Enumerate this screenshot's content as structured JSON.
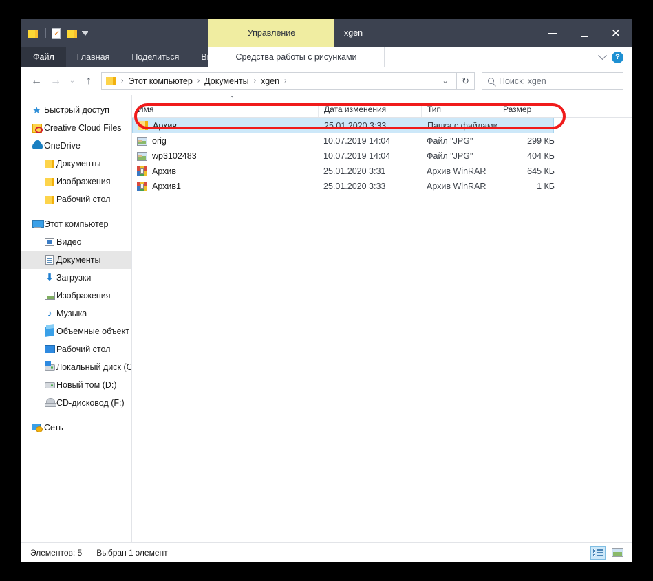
{
  "window": {
    "title": "xgen",
    "contextual_tab_header": "Управление",
    "controls": {
      "minimize": "–",
      "maximize": "□",
      "close": "✕"
    }
  },
  "quick_access_toolbar": {
    "items": [
      "new-folder-icon",
      "properties-icon",
      "open-folder-icon",
      "customize-dropdown-icon"
    ]
  },
  "ribbon": {
    "tabs": [
      {
        "label": "Файл",
        "active": true
      },
      {
        "label": "Главная",
        "active": false
      },
      {
        "label": "Поделиться",
        "active": false
      },
      {
        "label": "Вид",
        "active": false
      }
    ],
    "contextual_tab": "Средства работы с рисунками",
    "collapse_icon": "chevron-down-icon",
    "help_icon": "help-icon",
    "help_label": "?"
  },
  "address_bar": {
    "back_icon": "←",
    "forward_icon": "→",
    "recent_icon": "⌄",
    "up_icon": "↑",
    "breadcrumbs": [
      "Этот компьютер",
      "Документы",
      "xgen"
    ],
    "separator": "›",
    "dropdown_icon": "⌄",
    "refresh_icon": "↻"
  },
  "search": {
    "placeholder": "Поиск: xgen",
    "icon": "search-icon"
  },
  "sidebar": {
    "items": [
      {
        "label": "Быстрый доступ",
        "icon": "pin-star-icon",
        "level": 0,
        "selected": false
      },
      {
        "label": "Creative Cloud Files",
        "icon": "creative-cloud-icon",
        "level": 0,
        "selected": false
      },
      {
        "label": "OneDrive",
        "icon": "cloud-icon",
        "level": 0,
        "selected": false
      },
      {
        "label": "Документы",
        "icon": "folder-icon",
        "level": 1,
        "selected": false
      },
      {
        "label": "Изображения",
        "icon": "folder-icon",
        "level": 1,
        "selected": false
      },
      {
        "label": "Рабочий стол",
        "icon": "folder-icon",
        "level": 1,
        "selected": false
      },
      {
        "label": "Этот компьютер",
        "icon": "this-pc-icon",
        "level": 0,
        "selected": false
      },
      {
        "label": "Видео",
        "icon": "video-icon",
        "level": 1,
        "selected": false
      },
      {
        "label": "Документы",
        "icon": "documents-icon",
        "level": 1,
        "selected": true
      },
      {
        "label": "Загрузки",
        "icon": "downloads-icon",
        "level": 1,
        "selected": false
      },
      {
        "label": "Изображения",
        "icon": "pictures-icon",
        "level": 1,
        "selected": false
      },
      {
        "label": "Музыка",
        "icon": "music-icon",
        "level": 1,
        "selected": false
      },
      {
        "label": "Объемные объект",
        "icon": "3d-objects-icon",
        "level": 1,
        "selected": false
      },
      {
        "label": "Рабочий стол",
        "icon": "desktop-icon",
        "level": 1,
        "selected": false
      },
      {
        "label": "Локальный диск (C",
        "icon": "local-disk-icon",
        "level": 1,
        "selected": false
      },
      {
        "label": "Новый том (D:)",
        "icon": "drive-icon",
        "level": 1,
        "selected": false
      },
      {
        "label": "CD-дисковод (F:)",
        "icon": "cd-drive-icon",
        "level": 1,
        "selected": false
      },
      {
        "label": "Сеть",
        "icon": "network-icon",
        "level": 0,
        "selected": false
      }
    ]
  },
  "file_list": {
    "sort_indicator": "⌃",
    "columns": [
      {
        "key": "name",
        "label": "Имя"
      },
      {
        "key": "date",
        "label": "Дата изменения"
      },
      {
        "key": "type",
        "label": "Тип"
      },
      {
        "key": "size",
        "label": "Размер"
      }
    ],
    "rows": [
      {
        "name": "Архив",
        "date": "25.01.2020 3:33",
        "type": "Папка с файлами",
        "size": "",
        "icon": "folder-icon",
        "selected": true
      },
      {
        "name": "orig",
        "date": "10.07.2019 14:04",
        "type": "Файл \"JPG\"",
        "size": "299 КБ",
        "icon": "jpg-icon",
        "selected": false
      },
      {
        "name": "wp3102483",
        "date": "10.07.2019 14:04",
        "type": "Файл \"JPG\"",
        "size": "404 КБ",
        "icon": "jpg-icon",
        "selected": false
      },
      {
        "name": "Архив",
        "date": "25.01.2020 3:31",
        "type": "Архив WinRAR",
        "size": "645 КБ",
        "icon": "winrar-icon",
        "selected": false
      },
      {
        "name": "Архив1",
        "date": "25.01.2020 3:33",
        "type": "Архив WinRAR",
        "size": "1 КБ",
        "icon": "winrar-icon",
        "selected": false
      }
    ]
  },
  "status_bar": {
    "item_count": "Элементов: 5",
    "selection": "Выбран 1 элемент",
    "views": [
      {
        "name": "details-view",
        "active": true
      },
      {
        "name": "large-icons-view",
        "active": false
      }
    ]
  },
  "annotation": {
    "shape": "rounded-rectangle",
    "color": "#f01b1b",
    "target": "Архив"
  },
  "colors": {
    "titlebar": "#3c4250",
    "contextual_tab": "#f0eda1",
    "selection": "#cde8f9",
    "accent_red": "#f01b1b"
  }
}
